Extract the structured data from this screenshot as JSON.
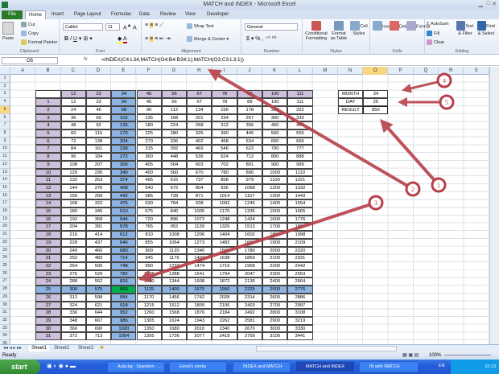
{
  "window": {
    "title": "MATCH and INDEX - Microsoft Excel"
  },
  "ribbon_tabs": [
    "File",
    "Home",
    "Insert",
    "Page Layout",
    "Formulas",
    "Data",
    "Review",
    "View",
    "Developer"
  ],
  "ribbon": {
    "clipboard": {
      "paste": "Paste",
      "cut": "Cut",
      "copy": "Copy",
      "format_painter": "Format Painter",
      "label": "Clipboard"
    },
    "font": {
      "name": "Calibri",
      "size": "11",
      "label": "Font"
    },
    "alignment": {
      "wrap": "Wrap Text",
      "merge": "Merge & Center",
      "label": "Alignment"
    },
    "number": {
      "format": "General",
      "label": "Number"
    },
    "styles": {
      "conditional": "Conditional Formatting",
      "format_table": "Format as Table",
      "cell_styles": "Cell Styles",
      "label": "Styles"
    },
    "cells": {
      "insert": "Insert",
      "delete": "Delete",
      "format": "Format",
      "label": "Cells"
    },
    "editing": {
      "autosum": "AutoSum",
      "fill": "Fill",
      "clear": "Clear",
      "sort": "Sort & Filter",
      "find": "Find & Select",
      "label": "Editing"
    }
  },
  "formula_bar": {
    "name_box": "O5",
    "fx": "fx",
    "formula": "=INDEX(C4:L34;MATCH(O4;B4:B34;1);MATCH(O3;C3:L3;1))"
  },
  "columns": [
    "A",
    "B",
    "C",
    "D",
    "E",
    "F",
    "G",
    "H",
    "I",
    "J",
    "K",
    "L",
    "M",
    "N",
    "O",
    "P",
    "Q",
    "R",
    "S"
  ],
  "selected_column": "O",
  "selected_row": 5,
  "row_count": 35,
  "colors": {
    "header_purple": "#ccc0da",
    "highlight_blue": "#8db4e2",
    "match_green": "#00b050",
    "arrow_red": "#b8404a"
  },
  "table": {
    "headers": [
      12,
      23,
      34,
      45,
      56,
      67,
      78,
      89,
      100,
      111
    ],
    "highlight_column_index": 2,
    "highlight_row_label": 25,
    "rows": [
      {
        "label": 1,
        "values": [
          12,
          23,
          34,
          45,
          56,
          67,
          78,
          89,
          100,
          111
        ]
      },
      {
        "label": 2,
        "values": [
          24,
          46,
          68,
          90,
          112,
          134,
          156,
          178,
          200,
          222
        ]
      },
      {
        "label": 3,
        "values": [
          36,
          69,
          102,
          135,
          168,
          201,
          234,
          267,
          300,
          333
        ]
      },
      {
        "label": 4,
        "values": [
          48,
          92,
          136,
          180,
          224,
          268,
          312,
          356,
          400,
          444
        ]
      },
      {
        "label": 5,
        "values": [
          60,
          115,
          170,
          225,
          280,
          335,
          390,
          445,
          500,
          555
        ]
      },
      {
        "label": 6,
        "values": [
          72,
          138,
          204,
          270,
          336,
          402,
          468,
          534,
          600,
          666
        ]
      },
      {
        "label": 7,
        "values": [
          84,
          161,
          238,
          315,
          392,
          469,
          546,
          623,
          700,
          777
        ]
      },
      {
        "label": 8,
        "values": [
          96,
          184,
          272,
          360,
          448,
          536,
          624,
          712,
          800,
          888
        ]
      },
      {
        "label": 9,
        "values": [
          108,
          207,
          306,
          405,
          504,
          603,
          702,
          801,
          900,
          999
        ]
      },
      {
        "label": 10,
        "values": [
          120,
          230,
          340,
          450,
          560,
          670,
          780,
          890,
          1000,
          1110
        ]
      },
      {
        "label": 11,
        "values": [
          132,
          253,
          374,
          495,
          616,
          737,
          858,
          979,
          1100,
          1221
        ]
      },
      {
        "label": 12,
        "values": [
          144,
          276,
          408,
          540,
          672,
          804,
          936,
          1068,
          1200,
          1332
        ]
      },
      {
        "label": 13,
        "values": [
          156,
          299,
          442,
          585,
          728,
          871,
          1014,
          1157,
          1300,
          1443
        ]
      },
      {
        "label": 14,
        "values": [
          168,
          322,
          476,
          630,
          784,
          938,
          1092,
          1246,
          1400,
          1554
        ]
      },
      {
        "label": 15,
        "values": [
          180,
          345,
          510,
          675,
          840,
          1005,
          1170,
          1335,
          1500,
          1665
        ]
      },
      {
        "label": 16,
        "values": [
          192,
          368,
          544,
          720,
          896,
          1072,
          1248,
          1424,
          1600,
          1776
        ]
      },
      {
        "label": 17,
        "values": [
          204,
          391,
          578,
          765,
          952,
          1139,
          1326,
          1513,
          1700,
          1887
        ]
      },
      {
        "label": 18,
        "values": [
          216,
          414,
          612,
          810,
          1008,
          1206,
          1404,
          1602,
          1800,
          1998
        ]
      },
      {
        "label": 19,
        "values": [
          228,
          437,
          646,
          855,
          1064,
          1273,
          1482,
          1691,
          1900,
          2109
        ]
      },
      {
        "label": 20,
        "values": [
          240,
          460,
          680,
          900,
          1120,
          1340,
          1560,
          1780,
          2000,
          2220
        ]
      },
      {
        "label": 21,
        "values": [
          252,
          483,
          714,
          945,
          1176,
          1407,
          1638,
          1869,
          2100,
          2331
        ]
      },
      {
        "label": 22,
        "values": [
          264,
          506,
          748,
          990,
          1232,
          1474,
          1716,
          1958,
          2200,
          2442
        ]
      },
      {
        "label": 23,
        "values": [
          276,
          529,
          782,
          1035,
          1288,
          1541,
          1794,
          2047,
          2300,
          2553
        ]
      },
      {
        "label": 24,
        "values": [
          288,
          552,
          816,
          1080,
          1344,
          1608,
          1872,
          2136,
          2400,
          2664
        ]
      },
      {
        "label": 25,
        "values": [
          300,
          575,
          850,
          1125,
          1400,
          1675,
          1950,
          2225,
          2500,
          2775
        ]
      },
      {
        "label": 26,
        "values": [
          312,
          598,
          884,
          1170,
          1456,
          1742,
          2028,
          2314,
          2600,
          2886
        ]
      },
      {
        "label": 27,
        "values": [
          324,
          621,
          918,
          1215,
          1512,
          1809,
          2106,
          2403,
          2700,
          2997
        ]
      },
      {
        "label": 28,
        "values": [
          336,
          644,
          952,
          1260,
          1568,
          1876,
          2184,
          2492,
          2800,
          3108
        ]
      },
      {
        "label": 29,
        "values": [
          348,
          667,
          986,
          1305,
          1624,
          1943,
          2262,
          2581,
          2900,
          3219
        ]
      },
      {
        "label": 30,
        "values": [
          360,
          690,
          1020,
          1350,
          1680,
          2010,
          2340,
          2670,
          3000,
          3330
        ]
      },
      {
        "label": 31,
        "values": [
          372,
          713,
          1054,
          1395,
          1736,
          2077,
          2418,
          2759,
          3100,
          3441
        ]
      }
    ]
  },
  "lookup": {
    "month_label": "MONTH",
    "month_value": "34",
    "day_label": "DAY",
    "day_value": "25",
    "result_label": "RESULT",
    "result_value": "850"
  },
  "annotations": [
    "1",
    "2",
    "3",
    "4",
    "5"
  ],
  "sheets": [
    "Sheet1",
    "Sheet2",
    "Sheet3"
  ],
  "status": {
    "ready": "Ready",
    "zoom": "100%"
  },
  "taskbar": {
    "start": "start",
    "items": [
      "Aula.bg - Question - ...",
      "Excel's works",
      "INDEX and MATCH",
      "MATCH and INDEX",
      "IN with MATCH"
    ],
    "active_index": 3,
    "lang": "EN",
    "clock": "10:13"
  }
}
